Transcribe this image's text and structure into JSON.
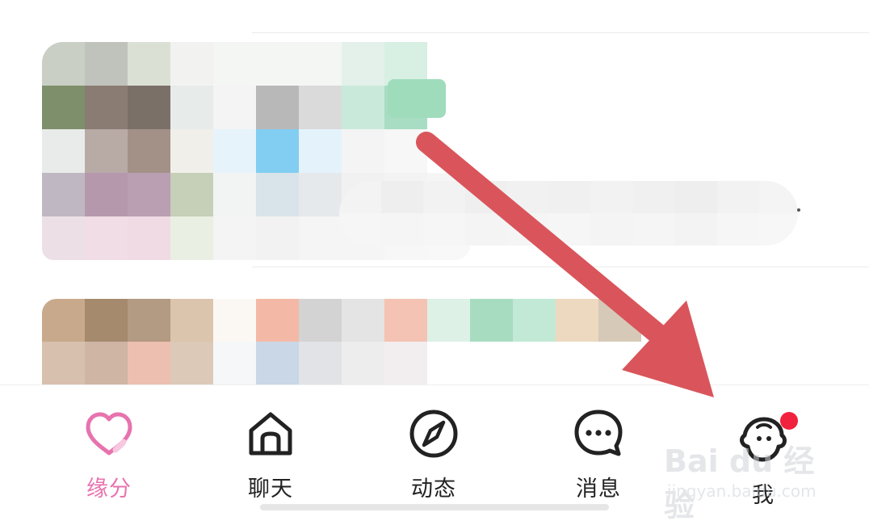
{
  "list": {
    "item1_colors": [
      "#c9cfc4",
      "#c0c3bc",
      "#dbe0d4",
      "#f2f3f1",
      "#f4f6f4",
      "#f4f6f4",
      "#f4f6f4",
      "#e3f1ea",
      "#d8efe3",
      "#ffffff",
      "#7e8f6b",
      "#8a7c72",
      "#7a7068",
      "#e7ebe9",
      "#f3f4f3",
      "#b8b8b8",
      "#dadada",
      "#c9eadb",
      "#a8dcc3",
      "#ffffff",
      "#e9ebea",
      "#b8aba6",
      "#a39187",
      "#f0efea",
      "#e7f3fb",
      "#82cdf2",
      "#e4f3fb",
      "#f4f4f4",
      "#f7f7f7",
      "#ffffff",
      "#bfb8c2",
      "#b698ad",
      "#ba9fb2",
      "#c6cfb7",
      "#f2f3f3",
      "#d9e3ea",
      "#e6e9eb",
      "#f1f1f1",
      "#f3f3f3",
      "#f5f5f5",
      "#ece0e6",
      "#f1dde5",
      "#f0dbe4",
      "#e9efe2",
      "#f4f4f4",
      "#f2f2f2",
      "#f5f5f5",
      "#f5f5f5",
      "#f7f7f7",
      "#f8f8f8"
    ],
    "item1_tail_colors": [
      "#f3f3f3",
      "#eeeeee",
      "#f2f2f2",
      "#efefef",
      "#f1f1f1",
      "#f0f0f0",
      "#f2f2f2",
      "#f0f0f0",
      "#eeeeee",
      "#f2f2f2",
      "#f4f4f4",
      "#f6f6f6",
      "#f5f5f5",
      "#f6f6f6",
      "#f4f4f4",
      "#f5f5f5",
      "#f6f6f6",
      "#f4f4f4",
      "#f5f5f5",
      "#f3f3f3",
      "#f6f6f6",
      "#f7f7f7"
    ],
    "item2_colors": [
      "#c8a98b",
      "#a68a6e",
      "#b39a82",
      "#dcc5ad",
      "#fbf8f4",
      "#f4b9a6",
      "#d3d3d3",
      "#e4e4e4",
      "#f4c3b3",
      "#ddf1e7",
      "#a8dcc1",
      "#c2e9d5",
      "#edd9bf",
      "#d6c9b7",
      "#d8c0ae",
      "#cfb5a4",
      "#ecbfb1",
      "#dcc9b7",
      "#f6f7f8",
      "#c9d7e6",
      "#e1e3e6",
      "#ededed",
      "#f2eef0",
      "#ffffff",
      "#ffffff",
      "#ffffff",
      "#ffffff",
      "#ffffff"
    ]
  },
  "tabbar": {
    "tabs": [
      {
        "label": "缘分",
        "icon": "heart-icon",
        "active": true
      },
      {
        "label": "聊天",
        "icon": "home-icon",
        "active": false
      },
      {
        "label": "动态",
        "icon": "compass-icon",
        "active": false
      },
      {
        "label": "消息",
        "icon": "chat-bubble-icon",
        "active": false
      },
      {
        "label": "我",
        "icon": "profile-face-icon",
        "active": false,
        "badge": "red-dot"
      }
    ]
  },
  "colors": {
    "active_tab": "#e773ae",
    "arrow": "#d9555b",
    "badge": "#f0223d"
  },
  "watermark": {
    "brand": "Bai du 经验",
    "url": "jingyan.baidu.com"
  }
}
